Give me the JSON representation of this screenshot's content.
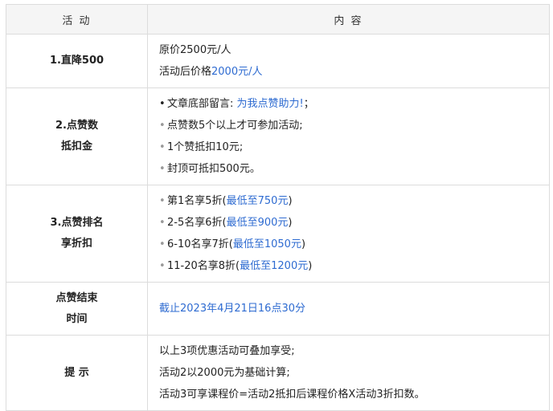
{
  "header": {
    "col1": "活 动",
    "col2": "内 容"
  },
  "rows": [
    {
      "label_lines": [
        "1.直降500"
      ],
      "content": [
        {
          "text": "原价2500元/人",
          "highlight": ""
        },
        {
          "text": "活动后价格",
          "highlight": "2000元/人"
        }
      ]
    },
    {
      "label_lines": [
        "2.点赞数",
        "抵扣金"
      ],
      "content": [
        {
          "text": "文章底部留言: ",
          "highlight": "为我点赞助力!",
          "suffix": "；"
        },
        {
          "text": "点赞数5个以上才可参加活动;",
          "highlight": "",
          "suffix": ""
        },
        {
          "text": "1个赞抵扣10元;",
          "highlight": "",
          "suffix": ""
        },
        {
          "text": "封顶可抵扣500元。",
          "highlight": "",
          "suffix": ""
        }
      ]
    },
    {
      "label_lines": [
        "3.点赞排名",
        "享折扣"
      ],
      "content": [
        {
          "text": "第1名享5折(",
          "highlight": "最低至750元",
          "suffix": ")"
        },
        {
          "text": "2-5名享6折(",
          "highlight": "最低至900元",
          "suffix": ")"
        },
        {
          "text": "6-10名享7折(",
          "highlight": "最低至1050元",
          "suffix": ")"
        },
        {
          "text": "11-20名享8折(",
          "highlight": "最低至1200元",
          "suffix": ")"
        }
      ]
    },
    {
      "label_lines": [
        "点赞结束",
        "时间"
      ],
      "content": [
        {
          "text": "",
          "highlight": "截止2023年4月21日16点30分"
        }
      ]
    },
    {
      "label_lines": [
        "提 示"
      ],
      "content": [
        {
          "text": "以上3项优惠活动可叠加享受;"
        },
        {
          "text": "活动2以2000元为基础计算;"
        },
        {
          "text": "活动3可享课程价=活动2抵扣后课程价格X活动3折扣数。"
        }
      ]
    }
  ]
}
